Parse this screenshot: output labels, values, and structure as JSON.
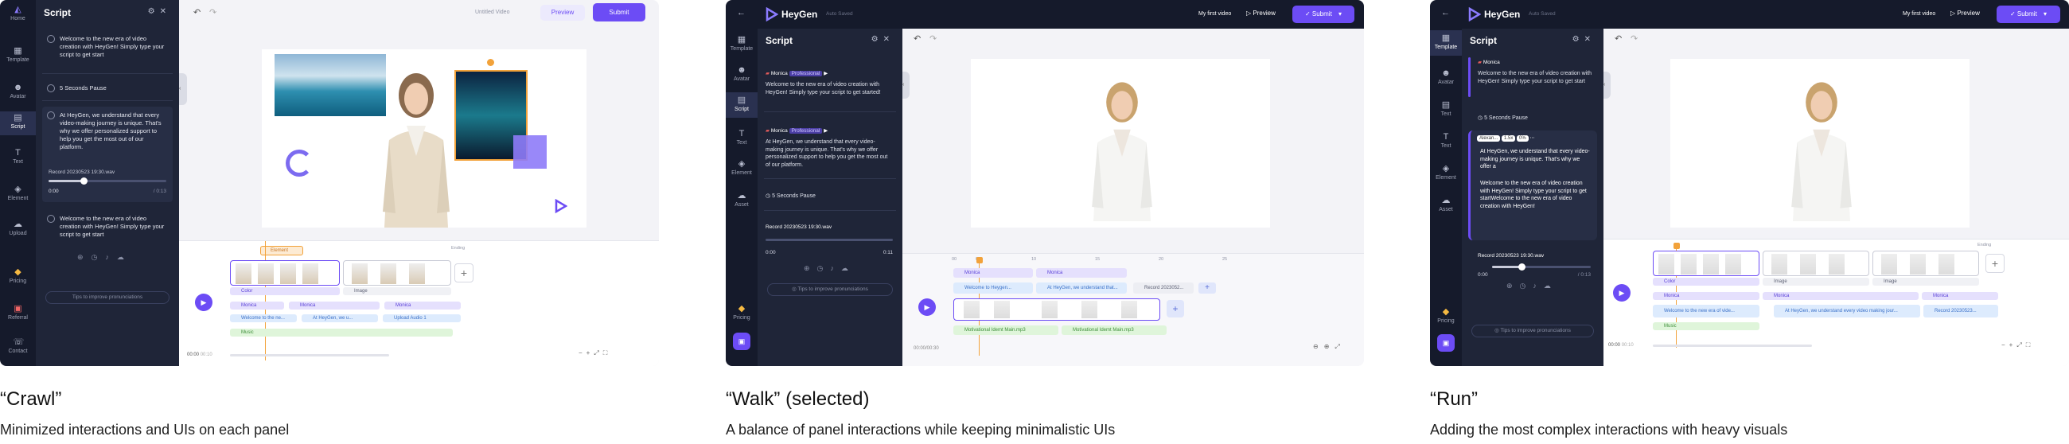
{
  "panels": [
    {
      "app": {
        "title": "Script",
        "logo_label": "Home"
      },
      "rail": [
        {
          "label": "Template",
          "icon": "template-icon"
        },
        {
          "label": "Avatar",
          "icon": "avatar-icon"
        },
        {
          "label": "Script",
          "icon": "script-icon",
          "active": true
        },
        {
          "label": "Text",
          "icon": "text-icon"
        },
        {
          "label": "Element",
          "icon": "element-icon"
        },
        {
          "label": "Upload",
          "icon": "upload-icon"
        },
        {
          "label": "Pricing",
          "icon": "pricing-icon"
        },
        {
          "label": "Referral",
          "icon": "referral-icon"
        },
        {
          "label": "Contact",
          "icon": "contact-icon"
        }
      ],
      "script_blocks": [
        "Welcome to the new era of video creation with HeyGen! Simply type your script to get start",
        "5 Seconds Pause",
        "At HeyGen, we understand that every video-making journey is unique. That's why we offer personalized support to help you get the most out of our platform.",
        "Welcome to the new era of video creation with HeyGen! Simply type your script to get start"
      ],
      "record": {
        "label": "Record 20230523 19:30.wav",
        "start": "0:00",
        "end": "/ 0:13"
      },
      "tips": "Tips to improve pronunciations",
      "topbar": {
        "video_title": "Untitled Video",
        "preview": "Preview",
        "submit": "Submit"
      },
      "timeline": {
        "element_tag": "Element",
        "ending": "Ending",
        "scene_labels": [
          "Color",
          "Image"
        ],
        "tracks": [
          "Monica",
          "Monica",
          "Monica"
        ],
        "script_tracks": [
          "Welcome to the ne...",
          "At HeyGen, we u...",
          "Upload Audio 1"
        ],
        "music": "Music",
        "time": "00:00",
        "time_total": "00:10"
      },
      "caption": {
        "title": "“Crawl”",
        "desc": "Minimized interactions and UIs on each panel"
      }
    },
    {
      "app": {
        "brand": "HeyGen",
        "auto_saved": "Auto Saved",
        "title": "Script"
      },
      "rail": [
        {
          "label": "Template",
          "icon": "template-icon"
        },
        {
          "label": "Avatar",
          "icon": "avatar-icon"
        },
        {
          "label": "Script",
          "icon": "script-icon",
          "active": true
        },
        {
          "label": "Text",
          "icon": "text-icon"
        },
        {
          "label": "Element",
          "icon": "element-icon"
        },
        {
          "label": "Asset",
          "icon": "asset-icon"
        },
        {
          "label": "Pricing",
          "icon": "pricing-icon"
        }
      ],
      "voice": {
        "name": "Monica",
        "badge": "Professional"
      },
      "script_blocks": [
        "Welcome to the new era of video creation with HeyGen! Simply type your script to get started!",
        "At HeyGen, we understand that every video-making journey is unique. That's why we offer personalized support to help you get the most out of our platform.",
        "5 Seconds Pause"
      ],
      "record": {
        "label": "Record 20230523 19:30.wav",
        "start": "0:00",
        "end": "0:11"
      },
      "tips": "Tips to improve pronunciations",
      "topbar": {
        "video_title": "My first video",
        "preview": "Preview",
        "submit": "Submit"
      },
      "timeline": {
        "ticks": [
          "00",
          "05",
          "10",
          "15",
          "20",
          "25"
        ],
        "tracks": [
          "Monica",
          "Monica"
        ],
        "script_tracks": [
          "Welcome to Heygen...",
          "At HeyGen, we understand that...",
          "Record 2023052..."
        ],
        "music": [
          "Motivational Idemt Main.mp3",
          "Motivational Idemt Main.mp3"
        ],
        "time": "00:00/00:30"
      },
      "caption": {
        "title": "“Walk” (selected)",
        "desc": "A balance of panel interactions while keeping minimalistic UIs"
      }
    },
    {
      "app": {
        "brand": "HeyGen",
        "auto_saved": "Auto Saved",
        "title": "Script"
      },
      "rail": [
        {
          "label": "Template",
          "icon": "template-icon",
          "active": true
        },
        {
          "label": "Avatar",
          "icon": "avatar-icon"
        },
        {
          "label": "Text",
          "icon": "text-icon"
        },
        {
          "label": "Text",
          "icon": "text-icon"
        },
        {
          "label": "Element",
          "icon": "element-icon"
        },
        {
          "label": "Asset",
          "icon": "asset-icon"
        },
        {
          "label": "Pricing",
          "icon": "pricing-icon"
        }
      ],
      "voice": {
        "name": "Monica",
        "chip_voice": "Alexan...",
        "chip_speed": "1.5x",
        "chip_pitch": "0%"
      },
      "script_blocks": [
        "Welcome to the new era of video creation with HeyGen! Simply type your script to get start",
        "5 Seconds Pause",
        "At HeyGen, we understand that every video-making journey is unique. That's why we offer a",
        "Welcome to the new era of video creation with HeyGen! Simply type your script to get startWelcome to the new era of video creation with HeyGen!"
      ],
      "record": {
        "label": "Record 20230523 19:30.wav",
        "start": "0:00",
        "end": "/ 0:13"
      },
      "tips": "Tips to improve pronunciations",
      "topbar": {
        "video_title": "My first video",
        "preview": "Preview",
        "submit": "Submit"
      },
      "timeline": {
        "ending": "Ending",
        "scene_labels": [
          "Color",
          "Image",
          "Image"
        ],
        "tracks": [
          "Monica",
          "Monica",
          "Monica"
        ],
        "script_tracks": [
          "Welcome to the new era of vide...",
          "At HeyGen, we understand every video making jour...",
          "Record 20230523..."
        ],
        "music": "Music",
        "time": "00:00",
        "time_total": "00:10"
      },
      "caption": {
        "title": "“Run”",
        "desc": "Adding the most complex interactions with heavy visuals"
      }
    }
  ]
}
